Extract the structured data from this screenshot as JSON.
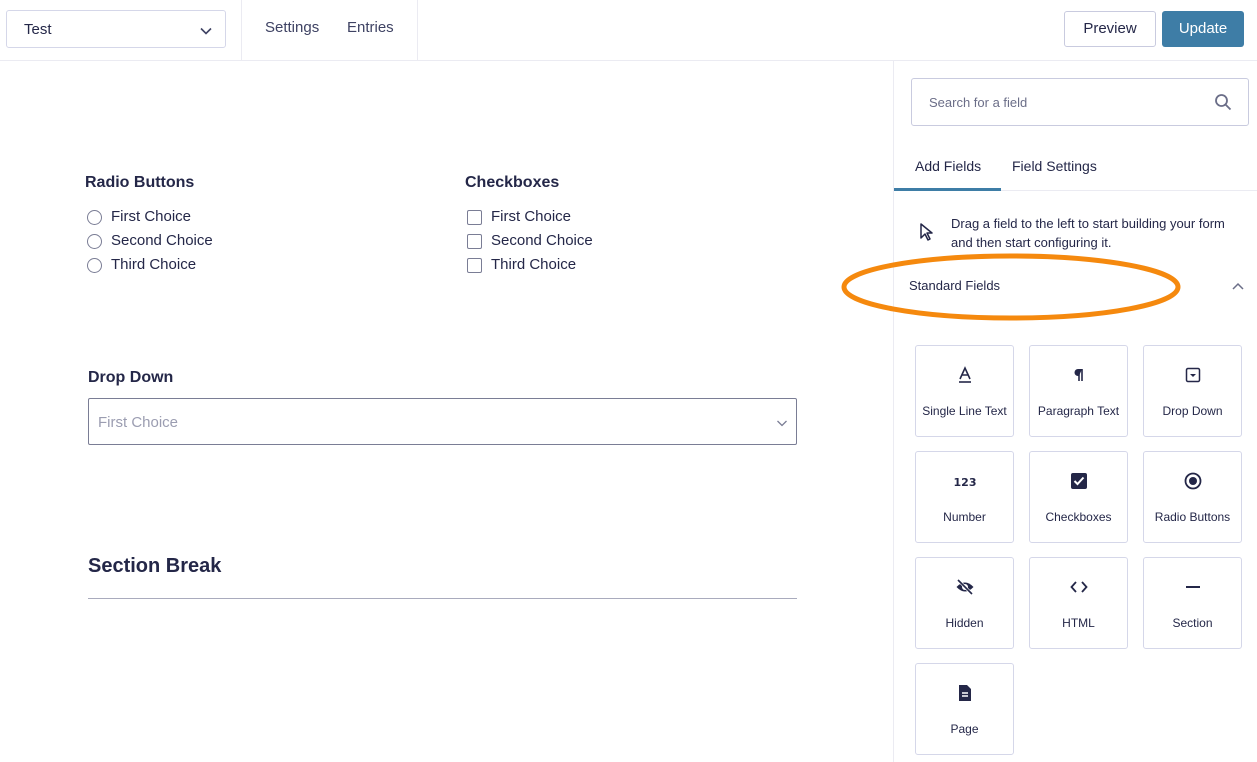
{
  "toolbar": {
    "form_name": "Test",
    "nav": [
      "Settings",
      "Entries"
    ],
    "preview_label": "Preview",
    "update_label": "Update"
  },
  "canvas": {
    "radio_field": {
      "title": "Radio Buttons",
      "choices": [
        "First Choice",
        "Second Choice",
        "Third Choice"
      ]
    },
    "checkbox_field": {
      "title": "Checkboxes",
      "choices": [
        "First Choice",
        "Second Choice",
        "Third Choice"
      ]
    },
    "dropdown_field": {
      "title": "Drop Down",
      "value": "First Choice"
    },
    "section_field": {
      "title": "Section Break"
    }
  },
  "sidebar": {
    "search_placeholder": "Search for a field",
    "tabs": [
      "Add Fields",
      "Field Settings"
    ],
    "active_tab": "Add Fields",
    "hint": "Drag a field to the left to start building your form and then start configuring it.",
    "group_title": "Standard Fields",
    "tiles": [
      {
        "label": "Single Line Text",
        "icon": "text-a-icon"
      },
      {
        "label": "Paragraph Text",
        "icon": "pilcrow-icon"
      },
      {
        "label": "Drop Down",
        "icon": "dropdown-icon"
      },
      {
        "label": "Number",
        "icon": "number-123-icon"
      },
      {
        "label": "Checkboxes",
        "icon": "checkbox-checked-icon"
      },
      {
        "label": "Radio Buttons",
        "icon": "radio-selected-icon"
      },
      {
        "label": "Hidden",
        "icon": "eye-off-icon"
      },
      {
        "label": "HTML",
        "icon": "code-brackets-icon"
      },
      {
        "label": "Section",
        "icon": "minus-icon"
      },
      {
        "label": "Page",
        "icon": "page-icon"
      }
    ]
  },
  "colors": {
    "accent": "#3e7da6",
    "highlight": "#f5890e",
    "text": "#242748"
  }
}
